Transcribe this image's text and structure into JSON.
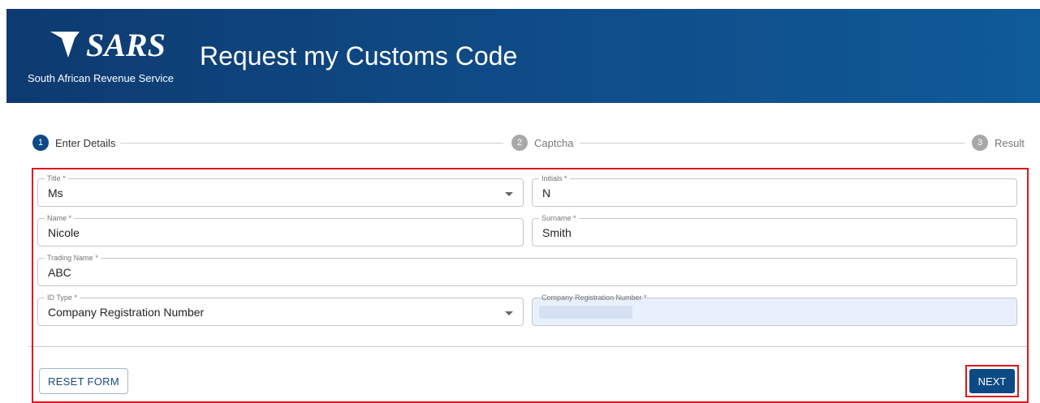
{
  "header": {
    "logo_text": "SARS",
    "logo_subtitle": "South African Revenue Service",
    "title": "Request my Customs Code"
  },
  "stepper": {
    "steps": [
      {
        "number": "1",
        "label": "Enter Details",
        "state": "active"
      },
      {
        "number": "2",
        "label": "Captcha",
        "state": "inactive"
      },
      {
        "number": "3",
        "label": "Result",
        "state": "inactive"
      }
    ]
  },
  "form": {
    "title": {
      "label": "Title *",
      "value": "Ms"
    },
    "initials": {
      "label": "Initials *",
      "value": "N"
    },
    "name": {
      "label": "Name *",
      "value": "Nicole"
    },
    "surname": {
      "label": "Surname *",
      "value": "Smith"
    },
    "trading_name": {
      "label": "Trading Name *",
      "value": "ABC"
    },
    "id_type": {
      "label": "ID Type *",
      "value": "Company Registration Number"
    },
    "company_reg": {
      "label": "Company Registration Number *",
      "value": ""
    }
  },
  "actions": {
    "reset_label": "RESET FORM",
    "next_label": "NEXT"
  },
  "colors": {
    "header_bg": "#0f4a85",
    "primary": "#0d4a85",
    "highlight": "#e0151d",
    "autofill_bg": "#e8f0fe"
  }
}
